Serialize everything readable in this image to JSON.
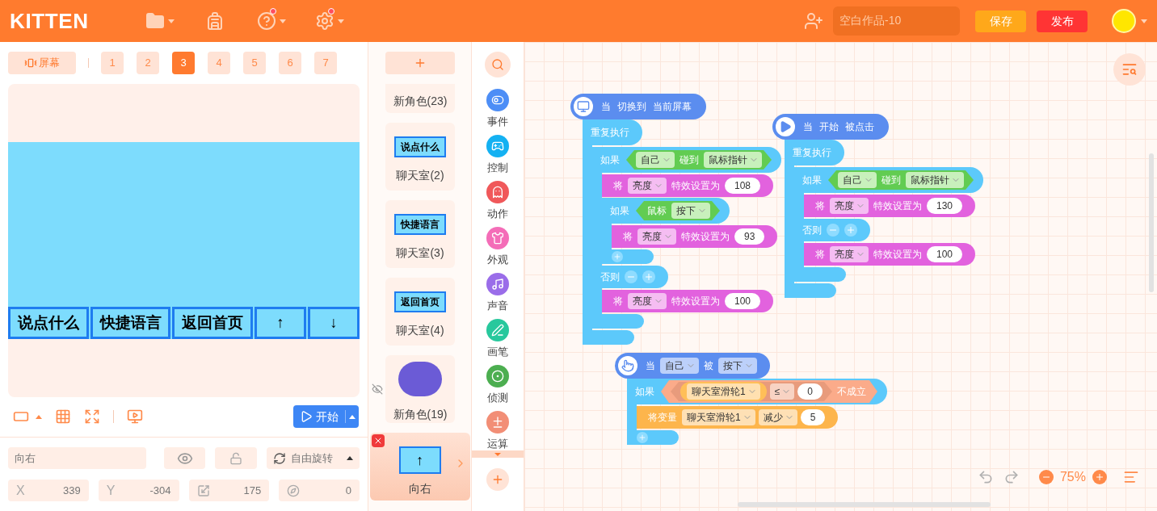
{
  "header": {
    "logo": "KITTEN",
    "project_name": "空白作品-10",
    "save": "保存",
    "publish": "发布"
  },
  "stage_toolbar": {
    "screen_button": "屏幕",
    "screens": [
      {
        "label": "1",
        "selected": false
      },
      {
        "label": "2",
        "selected": false
      },
      {
        "label": "3",
        "selected": true
      },
      {
        "label": "4",
        "selected": false
      },
      {
        "label": "5",
        "selected": false
      },
      {
        "label": "6",
        "selected": false
      },
      {
        "label": "7",
        "selected": false
      }
    ]
  },
  "stage": {
    "game_buttons": [
      "说点什么",
      "快捷语言",
      "返回首页",
      "↑",
      "↓"
    ]
  },
  "stage_controls": {
    "start_button": "开始"
  },
  "sprite_properties": {
    "name": "向右",
    "rotation_mode": "自由旋转",
    "x": {
      "label": "X",
      "value": "339"
    },
    "y": {
      "label": "Y",
      "value": "-304"
    },
    "size": "175",
    "direction": "0"
  },
  "sprites": [
    {
      "name": "新角色(23)",
      "kind": "clipped",
      "hidden": false,
      "selected": false
    },
    {
      "name": "聊天室(2)",
      "kind": "label",
      "label": "说点什么",
      "hidden": false,
      "selected": false
    },
    {
      "name": "聊天室(3)",
      "kind": "label",
      "label": "快捷语言",
      "hidden": false,
      "selected": false
    },
    {
      "name": "聊天室(4)",
      "kind": "label",
      "label": "返回首页",
      "hidden": false,
      "selected": false
    },
    {
      "name": "新角色(19)",
      "kind": "circle",
      "hidden": true,
      "selected": false
    },
    {
      "name": "向右",
      "kind": "label",
      "label": "↑",
      "hidden": false,
      "selected": true
    }
  ],
  "categories": [
    {
      "label": "事件",
      "color": "#4d8ef6"
    },
    {
      "label": "控制",
      "color": "#14b1f2"
    },
    {
      "label": "动作",
      "color": "#f0585a"
    },
    {
      "label": "外观",
      "color": "#f46db8"
    },
    {
      "label": "声音",
      "color": "#9a6de9"
    },
    {
      "label": "画笔",
      "color": "#28c89d"
    },
    {
      "label": "侦测",
      "color": "#4cae50"
    },
    {
      "label": "运算",
      "color": "#f28e76"
    }
  ],
  "scripts": [
    {
      "hat": {
        "kind": "screen",
        "parts": [
          {
            "kind": "text",
            "text": "当"
          },
          {
            "kind": "text",
            "text": "切换到"
          },
          {
            "kind": "text",
            "text": "当前屏幕"
          }
        ]
      },
      "blocks": [
        {
          "kind": "repeat",
          "label": "重复执行",
          "children": [
            {
              "kind": "if",
              "label": "如果",
              "condition": {
                "kind": "sensing",
                "parts": [
                  {
                    "kind": "dropdown",
                    "text": "自己"
                  },
                  {
                    "kind": "text",
                    "text": "碰到"
                  },
                  {
                    "kind": "dropdown",
                    "text": "鼠标指针"
                  }
                ]
              },
              "children": [
                {
                  "kind": "set",
                  "parts": [
                    {
                      "kind": "text",
                      "text": "将"
                    },
                    {
                      "kind": "dropdown",
                      "text": "亮度"
                    },
                    {
                      "kind": "text",
                      "text": "特效设置为"
                    },
                    {
                      "kind": "number",
                      "text": "108"
                    }
                  ]
                },
                {
                  "kind": "if",
                  "label": "如果",
                  "condition": {
                    "kind": "sensing",
                    "parts": [
                      {
                        "kind": "text",
                        "text": "鼠标"
                      },
                      {
                        "kind": "dropdown",
                        "text": "按下"
                      }
                    ]
                  },
                  "children": [
                    {
                      "kind": "set",
                      "parts": [
                        {
                          "kind": "text",
                          "text": "将"
                        },
                        {
                          "kind": "dropdown",
                          "text": "亮度"
                        },
                        {
                          "kind": "text",
                          "text": "特效设置为"
                        },
                        {
                          "kind": "number",
                          "text": "93"
                        }
                      ]
                    }
                  ]
                }
              ],
              "else": {
                "label": "否则",
                "children": [
                  {
                    "kind": "set",
                    "parts": [
                      {
                        "kind": "text",
                        "text": "将"
                      },
                      {
                        "kind": "dropdown",
                        "text": "亮度"
                      },
                      {
                        "kind": "text",
                        "text": "特效设置为"
                      },
                      {
                        "kind": "number",
                        "text": "100"
                      }
                    ]
                  }
                ]
              }
            }
          ]
        }
      ]
    },
    {
      "hat": {
        "kind": "flag",
        "parts": [
          {
            "kind": "text",
            "text": "当"
          },
          {
            "kind": "text",
            "text": "开始"
          },
          {
            "kind": "text",
            "text": "被点击"
          }
        ]
      },
      "blocks": [
        {
          "kind": "repeat",
          "label": "重复执行",
          "children": [
            {
              "kind": "if",
              "label": "如果",
              "condition": {
                "kind": "sensing",
                "parts": [
                  {
                    "kind": "dropdown",
                    "text": "自己"
                  },
                  {
                    "kind": "text",
                    "text": "碰到"
                  },
                  {
                    "kind": "dropdown",
                    "text": "鼠标指针"
                  }
                ]
              },
              "children": [
                {
                  "kind": "set",
                  "parts": [
                    {
                      "kind": "text",
                      "text": "将"
                    },
                    {
                      "kind": "dropdown",
                      "text": "亮度"
                    },
                    {
                      "kind": "text",
                      "text": "特效设置为"
                    },
                    {
                      "kind": "number",
                      "text": "130"
                    }
                  ]
                }
              ],
              "else": {
                "label": "否则",
                "children": [
                  {
                    "kind": "set",
                    "parts": [
                      {
                        "kind": "text",
                        "text": "将"
                      },
                      {
                        "kind": "dropdown",
                        "text": "亮度"
                      },
                      {
                        "kind": "text",
                        "text": "特效设置为"
                      },
                      {
                        "kind": "number",
                        "text": "100"
                      }
                    ]
                  }
                ]
              }
            }
          ]
        }
      ]
    },
    {
      "hat": {
        "kind": "tap",
        "parts": [
          {
            "kind": "text",
            "text": "当"
          },
          {
            "kind": "dropdown",
            "text": "自己"
          },
          {
            "kind": "text",
            "text": "被"
          },
          {
            "kind": "dropdown",
            "text": "按下"
          }
        ]
      },
      "blocks": [
        {
          "kind": "if",
          "label": "如果",
          "condition": {
            "kind": "not",
            "parts": [
              {
                "kind": "bool",
                "condition": {
                  "kind": "compare",
                  "parts": [
                    {
                      "kind": "reporter",
                      "parts": [
                        {
                          "kind": "dropdown",
                          "text": "聊天室滑轮1"
                        }
                      ]
                    },
                    {
                      "kind": "dropdown",
                      "text": "≤"
                    },
                    {
                      "kind": "number",
                      "text": "0"
                    }
                  ]
                }
              },
              {
                "kind": "text",
                "text": "不成立"
              }
            ]
          },
          "children": [
            {
              "kind": "var",
              "parts": [
                {
                  "kind": "text",
                  "text": "将变量"
                },
                {
                  "kind": "dropdown",
                  "text": "聊天室滑轮1"
                },
                {
                  "kind": "dropdown",
                  "text": "减少"
                },
                {
                  "kind": "number",
                  "text": "5"
                }
              ]
            }
          ]
        }
      ]
    }
  ],
  "zoom": {
    "level": "75%"
  }
}
